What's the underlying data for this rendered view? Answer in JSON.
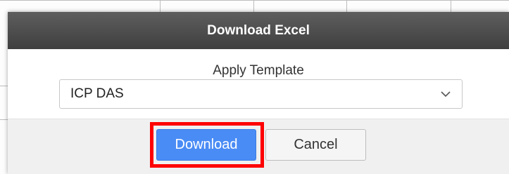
{
  "dialog": {
    "title": "Download Excel",
    "template_label": "Apply Template",
    "template_selected": "ICP DAS",
    "download_label": "Download",
    "cancel_label": "Cancel"
  },
  "icons": {
    "select_chevron": "chevron-down-icon"
  },
  "colors": {
    "header_bg": "#4d4d4d",
    "primary_button": "#4a8cf5",
    "highlight": "#ff0000",
    "footer_bg": "#f0f0f0"
  }
}
